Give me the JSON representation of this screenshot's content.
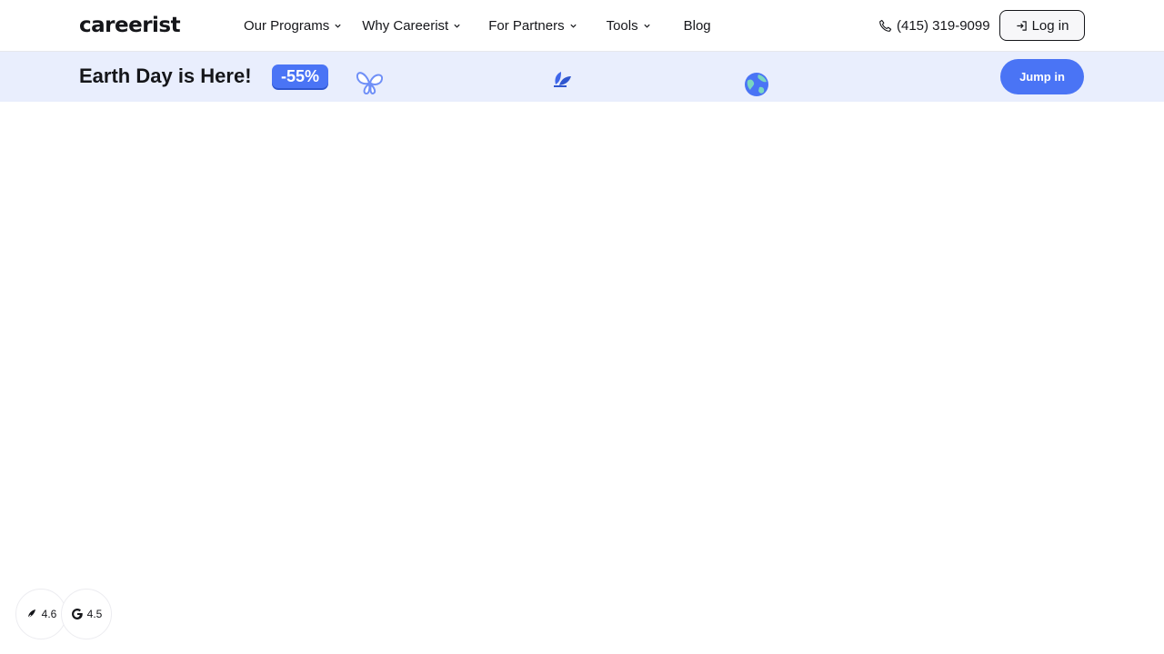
{
  "header": {
    "logo_text": "careerist",
    "nav": [
      {
        "label": "Our Programs",
        "has_dropdown": true,
        "name": "nav-our-programs"
      },
      {
        "label": "Why Careerist",
        "has_dropdown": true,
        "name": "nav-why-careerist"
      },
      {
        "label": "For Partners",
        "has_dropdown": true,
        "name": "nav-for-partners"
      },
      {
        "label": "Tools",
        "has_dropdown": true,
        "name": "nav-tools"
      },
      {
        "label": "Blog",
        "has_dropdown": false,
        "name": "nav-blog"
      }
    ],
    "phone": "(415) 319-9099",
    "phone_icon": "phone-icon",
    "login_label": "Log in",
    "login_icon": "login-arrow-icon"
  },
  "banner": {
    "title": "Earth Day is Here!",
    "discount": "-55%",
    "decorations": [
      "butterfly-icon",
      "leaves-icon",
      "globe-icon"
    ],
    "cta_label": "Jump in"
  },
  "ratings": [
    {
      "source_icon": "trustpilot-icon",
      "value": "4.6"
    },
    {
      "source_icon": "google-icon",
      "value": "4.5"
    }
  ],
  "colors": {
    "accent": "#4a74f5",
    "banner_bg": "#e9eefd",
    "text": "#15161a"
  }
}
